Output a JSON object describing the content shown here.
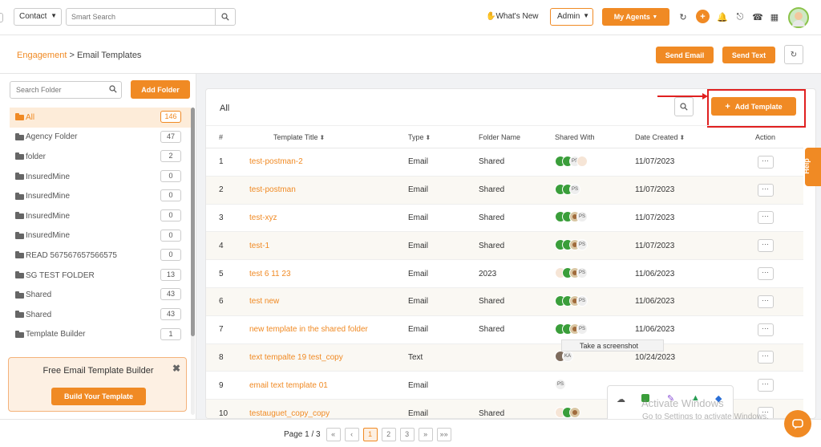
{
  "topbar": {
    "contact_label": "Contact",
    "search_placeholder": "Smart Search",
    "whats_new": "What's New",
    "admin_label": "Admin",
    "my_agents": "My Agents"
  },
  "subbar": {
    "crumb_link": "Engagement",
    "crumb_sep": " > ",
    "crumb_current": "Email Templates",
    "send_email": "Send Email",
    "send_text": "Send Text"
  },
  "folders": {
    "search_placeholder": "Search Folder",
    "add_folder": "Add Folder",
    "items": [
      {
        "label": "All",
        "count": "146"
      },
      {
        "label": "Agency Folder",
        "count": "47"
      },
      {
        "label": "folder",
        "count": "2"
      },
      {
        "label": "InsuredMine",
        "count": "0"
      },
      {
        "label": "InsuredMine",
        "count": "0"
      },
      {
        "label": "InsuredMine",
        "count": "0"
      },
      {
        "label": "InsuredMine",
        "count": "0"
      },
      {
        "label": "READ 567567657566575",
        "count": "0"
      },
      {
        "label": "SG TEST FOLDER",
        "count": "13"
      },
      {
        "label": "Shared",
        "count": "43"
      },
      {
        "label": "Shared",
        "count": "43"
      },
      {
        "label": "Template Builder",
        "count": "1"
      }
    ]
  },
  "promo": {
    "title": "Free Email Template Builder",
    "button": "Build Your Template",
    "close": "✖"
  },
  "main": {
    "title": "All",
    "add_template": "Add Template",
    "columns": {
      "num": "#",
      "title": "Template Title",
      "type": "Type",
      "folder": "Folder Name",
      "shared": "Shared With",
      "date": "Date Created",
      "action": "Action"
    },
    "rows": [
      {
        "num": "1",
        "title": "test-postman-2",
        "type": "Email",
        "folder": "Shared",
        "date": "11/07/2023",
        "avatars": [
          "green",
          "green",
          "ps",
          "hand"
        ]
      },
      {
        "num": "2",
        "title": "test-postman",
        "type": "Email",
        "folder": "Shared",
        "date": "11/07/2023",
        "avatars": [
          "green",
          "green",
          "ps"
        ]
      },
      {
        "num": "3",
        "title": "test-xyz",
        "type": "Email",
        "folder": "Shared",
        "date": "11/07/2023",
        "avatars": [
          "green",
          "green",
          "user",
          "ps"
        ]
      },
      {
        "num": "4",
        "title": "test-1",
        "type": "Email",
        "folder": "Shared",
        "date": "11/07/2023",
        "avatars": [
          "green",
          "green",
          "user",
          "ps"
        ]
      },
      {
        "num": "5",
        "title": "test 6 11 23",
        "type": "Email",
        "folder": "2023",
        "date": "11/06/2023",
        "avatars": [
          "hand",
          "green",
          "user",
          "ps"
        ]
      },
      {
        "num": "6",
        "title": "test new",
        "type": "Email",
        "folder": "Shared",
        "date": "11/06/2023",
        "avatars": [
          "green",
          "green",
          "user",
          "ps"
        ]
      },
      {
        "num": "7",
        "title": "new template in the shared folder",
        "type": "Email",
        "folder": "Shared",
        "date": "11/06/2023",
        "avatars": [
          "green",
          "green",
          "user",
          "ps"
        ]
      },
      {
        "num": "8",
        "title": "text tempalte 19 test_copy",
        "type": "Text",
        "folder": "",
        "date": "10/24/2023",
        "avatars": [
          "dark",
          "ka"
        ]
      },
      {
        "num": "9",
        "title": "email text template 01",
        "type": "Email",
        "folder": "",
        "date": "",
        "avatars": [
          "ps"
        ]
      },
      {
        "num": "10",
        "title": "testauguet_copy_copy",
        "type": "Email",
        "folder": "Shared",
        "date": "",
        "avatars": [
          "hand",
          "green",
          "user"
        ]
      }
    ],
    "action_label": "···"
  },
  "tooltip": "Take a screenshot",
  "pager": {
    "label": "Page 1 / 3",
    "first": "«",
    "prev": "‹",
    "pages": [
      "1",
      "2",
      "3"
    ],
    "next": "»",
    "last": "»»"
  },
  "help": "Help",
  "windows": {
    "activate_title": "Activate Windows",
    "activate_sub": "Go to Settings to activate Windows."
  },
  "colors": {
    "accent": "#f08a24",
    "highlight": "#e02020"
  }
}
